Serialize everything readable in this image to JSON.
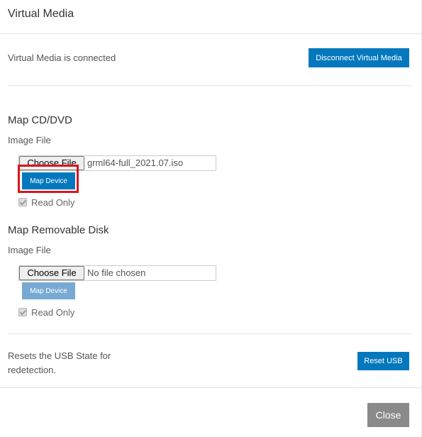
{
  "dialog": {
    "title": "Virtual Media"
  },
  "connection": {
    "status_text": "Virtual Media is connected",
    "disconnect_label": "Disconnect Virtual Media"
  },
  "cd_dvd": {
    "title": "Map CD/DVD",
    "image_file_label": "Image File",
    "choose_file_label": "Choose File",
    "file_name": "grml64-full_2021.07.iso",
    "map_device_label": "Map Device",
    "read_only_label": "Read Only",
    "read_only_checked": true,
    "map_device_enabled": true
  },
  "removable_disk": {
    "title": "Map Removable Disk",
    "image_file_label": "Image File",
    "choose_file_label": "Choose File",
    "file_name": "No file chosen",
    "map_device_label": "Map Device",
    "read_only_label": "Read Only",
    "read_only_checked": true,
    "map_device_enabled": false
  },
  "usb": {
    "description": "Resets the USB State for redetection.",
    "reset_label": "Reset USB"
  },
  "footer": {
    "close_label": "Close"
  },
  "colors": {
    "primary_button": "#0478bd",
    "disabled_button": "#78a9d3",
    "close_button": "#8a8a8a",
    "highlight": "#d9141e"
  }
}
